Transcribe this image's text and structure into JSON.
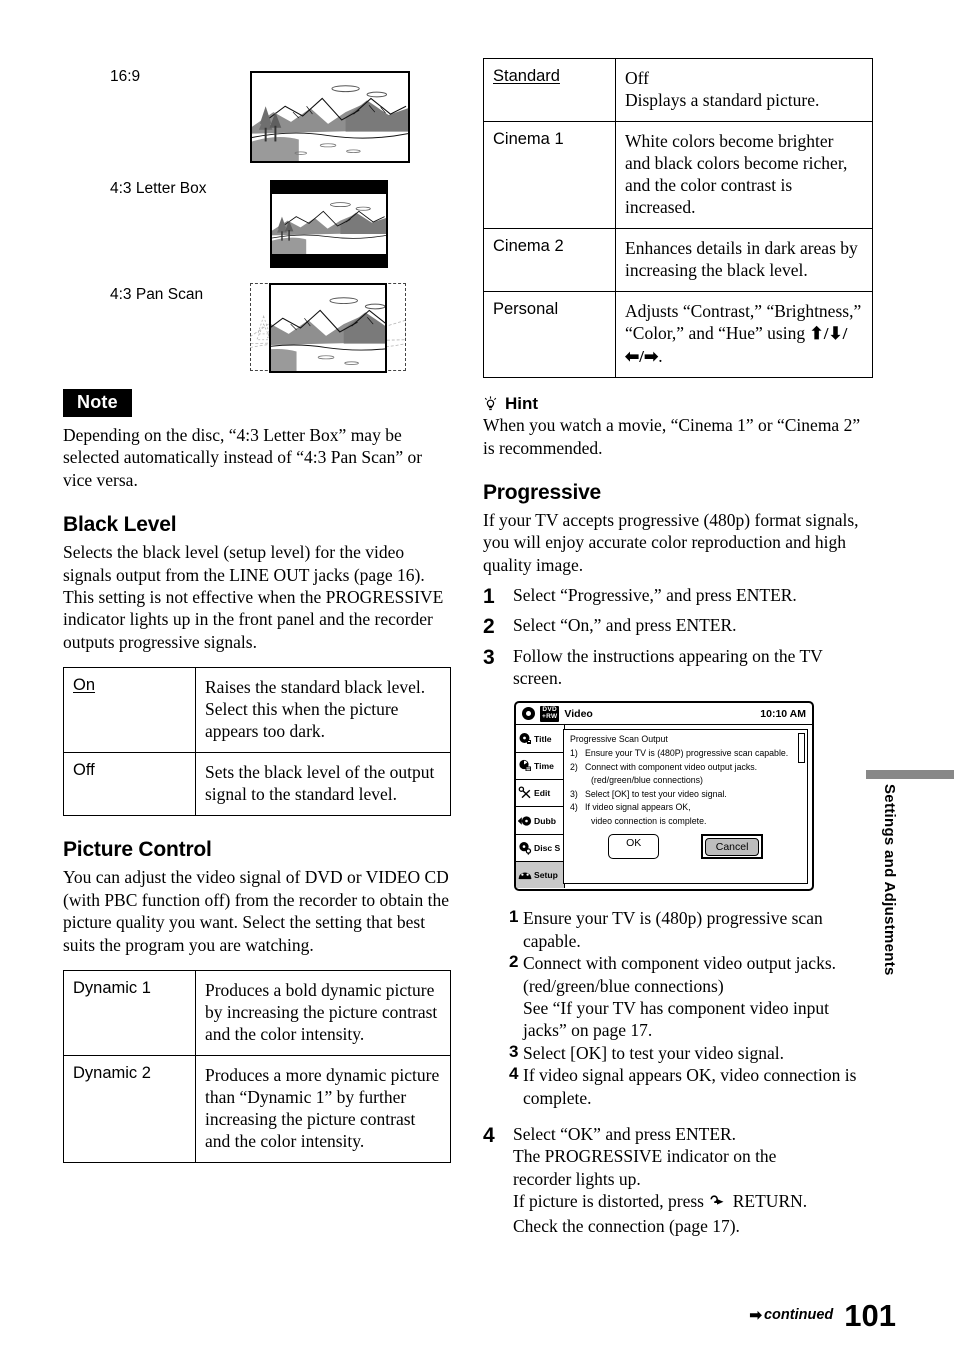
{
  "aspect_section": {
    "items": [
      {
        "label": "16:9",
        "icon": "widescreen-image"
      },
      {
        "label": "4:3 Letter Box",
        "icon": "letterbox-image"
      },
      {
        "label": "4:3 Pan Scan",
        "icon": "panscan-image"
      }
    ]
  },
  "note": {
    "badge": "Note",
    "text": "Depending on the disc, “4:3 Letter Box” may be selected automatically instead of “4:3 Pan Scan” or vice versa."
  },
  "black_level": {
    "heading": "Black Level",
    "body": "Selects the black level (setup level) for the video signals output from the LINE OUT jacks (page 16).\nThis setting is not effective when the PROGRESSIVE indicator lights up in the front panel and the recorder outputs progressive signals.",
    "body_lines": [
      "Selects the black level (setup level) for the video",
      "signals output from the LINE OUT jacks",
      "(page 16).",
      "This setting is not effective when the",
      "PROGRESSIVE indicator lights up in the front",
      "panel and the recorder outputs progressive signals."
    ],
    "table": [
      {
        "term": "On",
        "default": true,
        "desc": "Raises the standard black level. Select this when the picture appears too dark."
      },
      {
        "term": "Off",
        "default": false,
        "desc": "Sets the black level of the output signal to the standard level."
      }
    ]
  },
  "picture_control": {
    "heading": "Picture Control",
    "body": "You can adjust the video signal of DVD or VIDEO CD (with PBC function off) from the recorder to obtain the picture quality you want. Select the setting that best suits the program you are watching.",
    "table_left": [
      {
        "term": "Dynamic 1",
        "default": false,
        "desc": "Produces a bold dynamic picture by increasing the picture contrast and the color intensity."
      },
      {
        "term": "Dynamic 2",
        "default": false,
        "desc": "Produces a more dynamic picture than “Dynamic 1” by further increasing the picture contrast and the color intensity."
      }
    ],
    "table_right": [
      {
        "term": "Standard",
        "default": true,
        "desc_line1": "Off",
        "desc_line2": "Displays a standard picture."
      },
      {
        "term": "Cinema 1",
        "default": false,
        "desc": "White colors become brighter and black colors become richer, and the color contrast is increased."
      },
      {
        "term": "Cinema 2",
        "default": false,
        "desc": "Enhances details in dark areas by increasing the black level."
      },
      {
        "term": "Personal",
        "default": false,
        "desc_pre": "Adjusts “Contrast,” “Brightness,” “Color,” and “Hue” using ",
        "arrows": "⬆/⬇/⬅/➡",
        "desc_post": "."
      }
    ]
  },
  "hint": {
    "label": "Hint",
    "icon": "lightbulb-icon",
    "text": "When you watch a movie, “Cinema 1” or “Cinema 2” is recommended."
  },
  "progressive": {
    "heading": "Progressive",
    "body": "If your TV accepts progressive (480p) format signals, you will enjoy accurate color reproduction and high quality image.",
    "steps": [
      {
        "num": "1",
        "text": "Select “Progressive,” and press ENTER."
      },
      {
        "num": "2",
        "text": "Select “On,” and press ENTER."
      },
      {
        "num": "3",
        "text": "Follow the instructions appearing on the TV screen."
      }
    ],
    "substeps": [
      {
        "num": "1",
        "text": "Ensure your TV is (480p) progressive scan capable."
      },
      {
        "num": "2",
        "text": "Connect with component video output jacks. (red/green/blue connections)",
        "cont": "See “If your TV has component video input jacks”  on page 17."
      },
      {
        "num": "3",
        "text": "Select [OK] to test your video signal."
      },
      {
        "num": "4",
        "text": "If video signal appears OK, video connection is complete."
      }
    ],
    "final_step": {
      "num": "4",
      "lines": [
        "Select “OK” and press ENTER.",
        "The PROGRESSIVE indicator on the",
        "recorder lights up."
      ],
      "return_pre": "If picture is distorted, press ",
      "return_icon": "return-arrow-icon",
      "return_post": " RETURN.",
      "last_line": "Check the connection (page 17)."
    }
  },
  "tv_screen": {
    "header": {
      "rec_icon": "record-dot-icon",
      "disc_badge_top": "DVD",
      "disc_badge_bottom": "+RW",
      "title": "Video",
      "clock": "10:10 AM"
    },
    "sidebar": [
      {
        "label": "Title",
        "icon": "disc-title-icon",
        "selected": false
      },
      {
        "label": "Time",
        "icon": "timer-icon",
        "selected": false
      },
      {
        "label": "Edit",
        "icon": "scissors-icon",
        "selected": false
      },
      {
        "label": "Dubb",
        "icon": "dubbing-icon",
        "selected": false
      },
      {
        "label": "Disc S",
        "icon": "disc-setting-icon",
        "selected": false
      },
      {
        "label": "Setup",
        "icon": "setup-icon",
        "selected": true
      }
    ],
    "dialog": {
      "title": "Progressive Scan Output",
      "lines": [
        {
          "num": "1)",
          "text": "Ensure your TV is (480P) progressive scan capable."
        },
        {
          "num": "2)",
          "text": "Connect with component video output jacks."
        },
        {
          "num": "",
          "text": "(red/green/blue connections)",
          "indent": true
        },
        {
          "num": "3)",
          "text": "Select [OK] to test your video signal."
        },
        {
          "num": "4)",
          "text": "If video signal appears OK,"
        },
        {
          "num": "",
          "text": "video connection is complete.",
          "indent": true
        }
      ],
      "ok_label": "OK",
      "cancel_label": "Cancel"
    }
  },
  "running_head": "Settings and Adjustments",
  "footer": {
    "continued": "continued",
    "arrow": "➡",
    "page_number": "101"
  },
  "colors": {
    "accent_gray": "#888888",
    "highlight_gray": "#c9c9c9",
    "button_gray": "#bdbdbd",
    "text": "#000000"
  }
}
